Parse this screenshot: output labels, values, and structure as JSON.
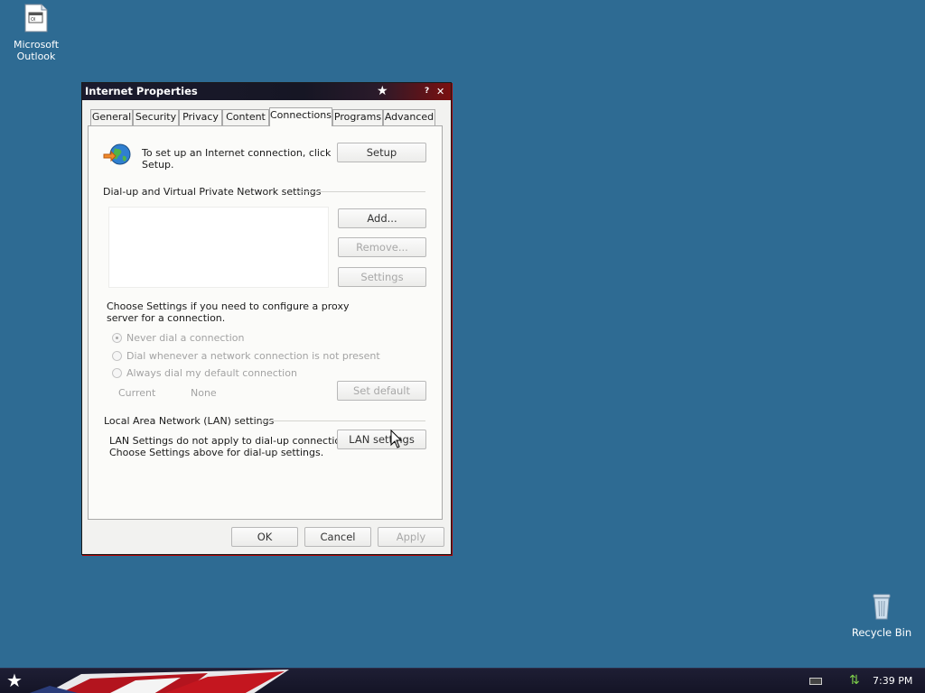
{
  "desktop": {
    "icons": [
      {
        "label_line1": "Microsoft",
        "label_line2": "Outlook"
      },
      {
        "label": "Recycle Bin"
      }
    ]
  },
  "window": {
    "title": "Internet Properties",
    "help_glyph": "?",
    "close_glyph": "✕",
    "tabs": [
      "General",
      "Security",
      "Privacy",
      "Content",
      "Connections",
      "Programs",
      "Advanced"
    ],
    "active_tab": "Connections",
    "setup_text_line1": "To set up an Internet connection, click",
    "setup_text_line2": "Setup.",
    "setup_button": "Setup",
    "dialup_heading": "Dial-up and Virtual Private Network settings",
    "add_button": "Add...",
    "remove_button": "Remove...",
    "settings_button": "Settings",
    "proxy_text_line1": "Choose Settings if you need to configure a proxy",
    "proxy_text_line2": "server for a connection.",
    "radio_options": [
      {
        "label": "Never dial a connection",
        "checked": true
      },
      {
        "label": "Dial whenever a network connection is not present",
        "checked": false
      },
      {
        "label": "Always dial my default connection",
        "checked": false
      }
    ],
    "current_label": "Current",
    "current_value": "None",
    "set_default_button": "Set default",
    "lan_heading": "Local Area Network (LAN) settings",
    "lan_text_line1": "LAN Settings do not apply to dial-up connections.",
    "lan_text_line2": "Choose Settings above for dial-up settings.",
    "lan_button": "LAN settings",
    "ok_button": "OK",
    "cancel_button": "Cancel",
    "apply_button": "Apply"
  },
  "taskbar": {
    "clock": "7:39 PM",
    "start_glyph": "★"
  },
  "colors": {
    "desktop_bg": "#2e6b93",
    "titlebar_accent": "#7a1010",
    "taskbar_bg": "#141426"
  }
}
